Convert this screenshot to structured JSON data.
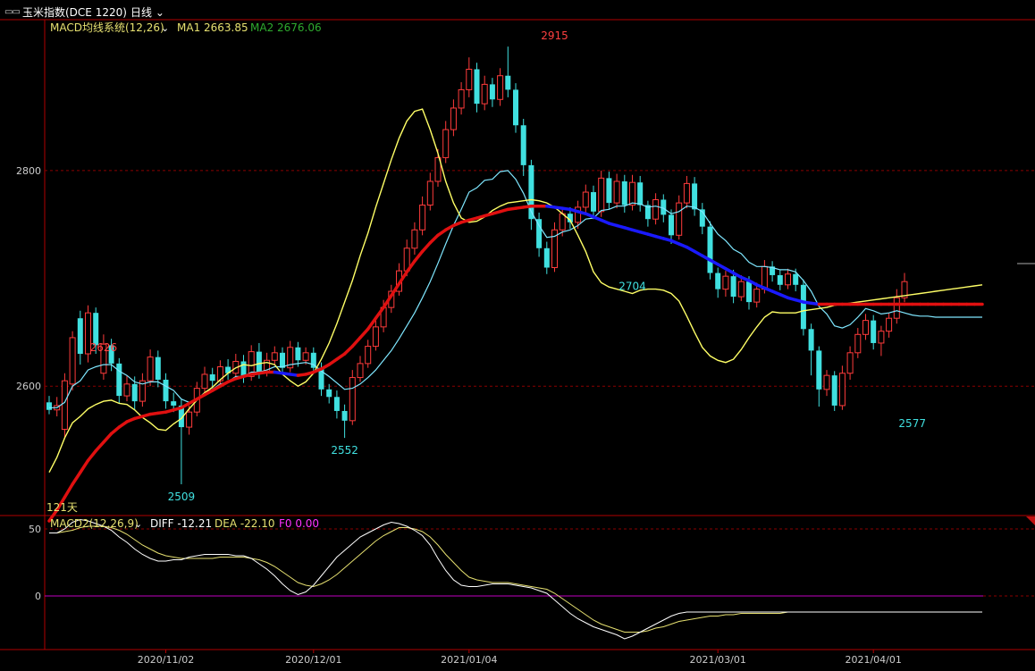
{
  "header": {
    "window_icon": "window-icon",
    "title": "玉米指数(DCE 1220)",
    "period": "日线",
    "period_dropdown_icon": "chevron-down-icon"
  },
  "main_panel": {
    "indicator_name": "MACD均线系统(12,26)",
    "ma1_label": "MA1 2663.85",
    "ma2_label": "MA2 2676.06",
    "day_count_label": "121天",
    "y_ticks": [
      {
        "value": 2800,
        "label": "2800"
      },
      {
        "value": 2600,
        "label": "2600"
      }
    ],
    "peak_labels": [
      {
        "index": 7,
        "value": 2626,
        "label": "2626",
        "kind": "high"
      },
      {
        "index": 17,
        "value": 2509,
        "label": "2509",
        "kind": "low"
      },
      {
        "index": 38,
        "value": 2552,
        "label": "2552",
        "kind": "low"
      },
      {
        "index": 65,
        "value": 2915,
        "label": "2915",
        "kind": "high"
      },
      {
        "index": 75,
        "value": 2704,
        "label": "2704",
        "kind": "low"
      },
      {
        "index": 111,
        "value": 2577,
        "label": "2577",
        "kind": "low"
      }
    ]
  },
  "sub_panel": {
    "indicator_name": "MACD2(12,26,9)",
    "diff_label": "DIFF -12.21",
    "dea_label": "DEA -22.10",
    "f0_label": "F0 0.00",
    "y_ticks": [
      {
        "value": 50,
        "label": "50"
      },
      {
        "value": 0,
        "label": "0"
      }
    ]
  },
  "x_axis": {
    "date_labels": [
      {
        "index": 15,
        "label": "2020/11/02"
      },
      {
        "index": 34,
        "label": "2020/12/01"
      },
      {
        "index": 54,
        "label": "2021/01/04"
      },
      {
        "index": 86,
        "label": "2021/03/01"
      },
      {
        "index": 106,
        "label": "2021/04/01"
      }
    ]
  },
  "colors": {
    "up": "#ff3b3b",
    "down": "#40e0e0",
    "ma1": "#ffff66",
    "ma2_up": "#e01010",
    "ma2_down": "#1a1aff",
    "ema_fast": "#7fe7ff",
    "grid": "#8b0000",
    "axis": "#b00000",
    "diff": "#ffffff",
    "dea": "#e6e070",
    "zero": "#c000c0"
  },
  "chart_data": {
    "type": "candlestick",
    "period": "daily",
    "count": 121,
    "ylim_main": [
      2480,
      2940
    ],
    "ylim_macd": [
      -40,
      60
    ],
    "candles": [
      [
        2585,
        2578,
        2591,
        2574
      ],
      [
        2578,
        2582,
        2590,
        2572
      ],
      [
        2560,
        2605,
        2612,
        2552
      ],
      [
        2602,
        2645,
        2651,
        2596
      ],
      [
        2663,
        2630,
        2670,
        2620
      ],
      [
        2630,
        2668,
        2675,
        2622
      ],
      [
        2668,
        2638,
        2673,
        2630
      ],
      [
        2612,
        2639,
        2648,
        2606
      ],
      [
        2638,
        2621,
        2644,
        2614
      ],
      [
        2621,
        2591,
        2626,
        2584
      ],
      [
        2591,
        2602,
        2610,
        2586
      ],
      [
        2602,
        2586,
        2609,
        2578
      ],
      [
        2586,
        2605,
        2612,
        2581
      ],
      [
        2605,
        2627,
        2634,
        2600
      ],
      [
        2627,
        2606,
        2633,
        2599
      ],
      [
        2606,
        2586,
        2612,
        2579
      ],
      [
        2586,
        2582,
        2594,
        2576
      ],
      [
        2582,
        2562,
        2588,
        2509
      ],
      [
        2562,
        2576,
        2582,
        2555
      ],
      [
        2576,
        2598,
        2604,
        2572
      ],
      [
        2598,
        2611,
        2618,
        2592
      ],
      [
        2611,
        2605,
        2617,
        2598
      ],
      [
        2605,
        2618,
        2624,
        2600
      ],
      [
        2618,
        2612,
        2625,
        2606
      ],
      [
        2612,
        2623,
        2630,
        2607
      ],
      [
        2623,
        2609,
        2629,
        2603
      ],
      [
        2609,
        2632,
        2638,
        2605
      ],
      [
        2632,
        2613,
        2640,
        2607
      ],
      [
        2613,
        2624,
        2631,
        2609
      ],
      [
        2624,
        2631,
        2637,
        2620
      ],
      [
        2631,
        2617,
        2636,
        2611
      ],
      [
        2617,
        2636,
        2642,
        2613
      ],
      [
        2636,
        2624,
        2641,
        2618
      ],
      [
        2624,
        2631,
        2636,
        2620
      ],
      [
        2631,
        2617,
        2636,
        2612
      ],
      [
        2617,
        2597,
        2622,
        2591
      ],
      [
        2597,
        2590,
        2602,
        2584
      ],
      [
        2590,
        2577,
        2596,
        2570
      ],
      [
        2577,
        2568,
        2583,
        2552
      ],
      [
        2568,
        2608,
        2615,
        2564
      ],
      [
        2608,
        2621,
        2628,
        2604
      ],
      [
        2621,
        2637,
        2643,
        2617
      ],
      [
        2637,
        2655,
        2661,
        2633
      ],
      [
        2655,
        2673,
        2680,
        2650
      ],
      [
        2673,
        2688,
        2694,
        2668
      ],
      [
        2688,
        2707,
        2714,
        2684
      ],
      [
        2707,
        2728,
        2736,
        2702
      ],
      [
        2728,
        2745,
        2752,
        2722
      ],
      [
        2745,
        2768,
        2776,
        2740
      ],
      [
        2768,
        2790,
        2798,
        2763
      ],
      [
        2790,
        2812,
        2820,
        2785
      ],
      [
        2812,
        2838,
        2846,
        2807
      ],
      [
        2838,
        2858,
        2866,
        2832
      ],
      [
        2858,
        2875,
        2882,
        2852
      ],
      [
        2875,
        2894,
        2905,
        2868
      ],
      [
        2894,
        2862,
        2900,
        2854
      ],
      [
        2862,
        2880,
        2888,
        2856
      ],
      [
        2880,
        2866,
        2886,
        2859
      ],
      [
        2866,
        2888,
        2895,
        2860
      ],
      [
        2888,
        2875,
        2915,
        2868
      ],
      [
        2875,
        2842,
        2881,
        2835
      ],
      [
        2842,
        2805,
        2848,
        2795
      ],
      [
        2805,
        2755,
        2810,
        2745
      ],
      [
        2755,
        2728,
        2761,
        2720
      ],
      [
        2728,
        2710,
        2734,
        2704
      ],
      [
        2710,
        2745,
        2752,
        2706
      ],
      [
        2745,
        2760,
        2766,
        2739
      ],
      [
        2760,
        2752,
        2766,
        2746
      ],
      [
        2752,
        2766,
        2772,
        2746
      ],
      [
        2766,
        2780,
        2787,
        2760
      ],
      [
        2780,
        2762,
        2786,
        2755
      ],
      [
        2762,
        2793,
        2800,
        2757
      ],
      [
        2793,
        2770,
        2799,
        2764
      ],
      [
        2770,
        2790,
        2797,
        2765
      ],
      [
        2790,
        2768,
        2796,
        2761
      ],
      [
        2768,
        2789,
        2796,
        2763
      ],
      [
        2789,
        2768,
        2795,
        2762
      ],
      [
        2768,
        2755,
        2772,
        2748
      ],
      [
        2755,
        2773,
        2779,
        2750
      ],
      [
        2773,
        2759,
        2778,
        2752
      ],
      [
        2759,
        2740,
        2764,
        2732
      ],
      [
        2740,
        2770,
        2777,
        2736
      ],
      [
        2770,
        2788,
        2795,
        2765
      ],
      [
        2788,
        2764,
        2794,
        2758
      ],
      [
        2764,
        2748,
        2770,
        2741
      ],
      [
        2748,
        2705,
        2753,
        2699
      ],
      [
        2705,
        2690,
        2710,
        2682
      ],
      [
        2690,
        2702,
        2707,
        2683
      ],
      [
        2702,
        2683,
        2708,
        2677
      ],
      [
        2683,
        2697,
        2703,
        2679
      ],
      [
        2697,
        2678,
        2702,
        2671
      ],
      [
        2678,
        2690,
        2696,
        2673
      ],
      [
        2690,
        2711,
        2717,
        2686
      ],
      [
        2711,
        2703,
        2716,
        2697
      ],
      [
        2703,
        2694,
        2708,
        2689
      ],
      [
        2694,
        2704,
        2709,
        2690
      ],
      [
        2704,
        2694,
        2709,
        2688
      ],
      [
        2694,
        2653,
        2699,
        2647
      ],
      [
        2653,
        2633,
        2658,
        2610
      ],
      [
        2633,
        2597,
        2637,
        2581
      ],
      [
        2597,
        2610,
        2615,
        2591
      ],
      [
        2610,
        2582,
        2614,
        2577
      ],
      [
        2582,
        2612,
        2619,
        2578
      ],
      [
        2612,
        2631,
        2637,
        2606
      ],
      [
        2631,
        2648,
        2654,
        2626
      ],
      [
        2648,
        2661,
        2667,
        2643
      ],
      [
        2661,
        2640,
        2666,
        2634
      ],
      [
        2640,
        2651,
        2656,
        2628
      ],
      [
        2651,
        2663,
        2668,
        2645
      ],
      [
        2663,
        2682,
        2690,
        2658
      ],
      [
        2682,
        2697,
        2705,
        2678
      ]
    ],
    "ma1": [
      2520,
      2534,
      2552,
      2566,
      2572,
      2579,
      2583,
      2586,
      2587,
      2584,
      2583,
      2578,
      2571,
      2566,
      2560,
      2559,
      2565,
      2570,
      2579,
      2587,
      2594,
      2599,
      2606,
      2612,
      2617,
      2620,
      2619,
      2621,
      2622,
      2620,
      2611,
      2605,
      2600,
      2604,
      2612,
      2625,
      2640,
      2658,
      2678,
      2698,
      2721,
      2742,
      2766,
      2788,
      2810,
      2830,
      2846,
      2855,
      2857,
      2838,
      2816,
      2790,
      2770,
      2756,
      2752,
      2753,
      2757,
      2763,
      2767,
      2770,
      2771,
      2772,
      2773,
      2772,
      2770,
      2766,
      2760,
      2754,
      2740,
      2725,
      2706,
      2696,
      2692,
      2690,
      2688,
      2686,
      2689,
      2690,
      2690,
      2689,
      2686,
      2679,
      2665,
      2650,
      2636,
      2628,
      2624,
      2622,
      2625,
      2634,
      2645,
      2655,
      2664,
      2669,
      2668,
      2668,
      2668,
      2670,
      2671,
      2672,
      2673,
      2675,
      2676,
      2677,
      2678,
      2679,
      2680,
      2681,
      2682,
      2683,
      2684,
      2685,
      2686,
      2687,
      2688,
      2689,
      2690,
      2691,
      2692,
      2693,
      2694
    ],
    "ma2": [
      2475,
      2485,
      2497,
      2509,
      2520,
      2531,
      2540,
      2548,
      2556,
      2562,
      2567,
      2570,
      2572,
      2574,
      2575,
      2576,
      2578,
      2580,
      2584,
      2588,
      2592,
      2596,
      2600,
      2604,
      2607,
      2609,
      2611,
      2612,
      2613,
      2613,
      2612,
      2611,
      2610,
      2611,
      2613,
      2616,
      2620,
      2625,
      2630,
      2637,
      2645,
      2653,
      2663,
      2673,
      2684,
      2695,
      2706,
      2716,
      2725,
      2733,
      2740,
      2745,
      2749,
      2752,
      2754,
      2756,
      2758,
      2760,
      2762,
      2764,
      2765,
      2766,
      2767,
      2767,
      2767,
      2766,
      2765,
      2764,
      2762,
      2760,
      2757,
      2754,
      2751,
      2749,
      2747,
      2745,
      2743,
      2741,
      2739,
      2737,
      2735,
      2732,
      2729,
      2725,
      2721,
      2717,
      2713,
      2709,
      2705,
      2701,
      2698,
      2694,
      2691,
      2688,
      2685,
      2682,
      2680,
      2678,
      2677,
      2676,
      2676,
      2676,
      2676,
      2676,
      2676,
      2676,
      2676,
      2676,
      2676,
      2676,
      2676,
      2676,
      2676,
      2676,
      2676,
      2676,
      2676,
      2676,
      2676,
      2676,
      2676
    ],
    "ema_fast": [
      2580,
      2580,
      2585,
      2600,
      2605,
      2615,
      2618,
      2620,
      2620,
      2614,
      2610,
      2604,
      2602,
      2604,
      2604,
      2600,
      2596,
      2588,
      2585,
      2588,
      2594,
      2597,
      2602,
      2604,
      2609,
      2609,
      2613,
      2613,
      2615,
      2618,
      2618,
      2620,
      2621,
      2622,
      2620,
      2614,
      2609,
      2603,
      2597,
      2598,
      2602,
      2608,
      2615,
      2624,
      2633,
      2644,
      2656,
      2668,
      2682,
      2697,
      2714,
      2732,
      2749,
      2764,
      2780,
      2784,
      2791,
      2792,
      2799,
      2800,
      2792,
      2779,
      2762,
      2749,
      2738,
      2739,
      2743,
      2745,
      2749,
      2755,
      2756,
      2763,
      2764,
      2767,
      2767,
      2770,
      2769,
      2766,
      2767,
      2765,
      2760,
      2762,
      2767,
      2766,
      2762,
      2751,
      2741,
      2735,
      2727,
      2723,
      2715,
      2711,
      2711,
      2710,
      2708,
      2708,
      2706,
      2698,
      2688,
      2674,
      2667,
      2656,
      2654,
      2657,
      2664,
      2672,
      2670,
      2667,
      2668,
      2670,
      2668,
      2666,
      2665,
      2665,
      2664,
      2664,
      2664,
      2664,
      2664,
      2664,
      2664
    ],
    "diff": [
      47,
      47,
      50,
      55,
      57,
      56,
      54,
      52,
      49,
      44,
      40,
      35,
      31,
      28,
      26,
      26,
      27,
      27,
      29,
      30,
      31,
      31,
      31,
      31,
      30,
      30,
      28,
      24,
      20,
      15,
      9,
      4,
      1,
      3,
      8,
      15,
      22,
      29,
      34,
      39,
      44,
      47,
      50,
      53,
      55,
      54,
      52,
      49,
      45,
      38,
      28,
      19,
      12,
      8,
      7,
      7,
      8,
      9,
      9,
      9,
      8,
      7,
      6,
      4,
      2,
      -3,
      -8,
      -13,
      -17,
      -20,
      -23,
      -25,
      -27,
      -29,
      -32,
      -30,
      -27,
      -24,
      -21,
      -18,
      -15,
      -13,
      -12,
      -12,
      -12,
      -12,
      -12,
      -12,
      -12,
      -12,
      -12,
      -12,
      -12,
      -12,
      -12,
      -12,
      -12,
      -12,
      -12,
      -12,
      -12,
      -12,
      -12,
      -12,
      -12,
      -12,
      -12,
      -12,
      -12,
      -12,
      -12,
      -12,
      -12,
      -12,
      -12,
      -12,
      -12,
      -12,
      -12,
      -12,
      -12
    ],
    "dea": [
      47,
      47,
      48,
      49,
      51,
      52,
      52,
      52,
      51,
      49,
      46,
      42,
      38,
      35,
      32,
      30,
      29,
      28,
      28,
      28,
      28,
      28,
      29,
      29,
      29,
      29,
      28,
      27,
      25,
      22,
      18,
      14,
      10,
      8,
      7,
      9,
      12,
      16,
      21,
      26,
      31,
      36,
      41,
      45,
      48,
      51,
      51,
      50,
      48,
      44,
      38,
      31,
      25,
      19,
      14,
      12,
      11,
      10,
      10,
      10,
      9,
      8,
      7,
      6,
      5,
      2,
      -2,
      -6,
      -10,
      -14,
      -18,
      -21,
      -23,
      -25,
      -27,
      -27,
      -27,
      -26,
      -24,
      -23,
      -21,
      -19,
      -18,
      -17,
      -16,
      -15,
      -15,
      -14,
      -14,
      -13,
      -13,
      -13,
      -13,
      -13,
      -13,
      -12,
      -12,
      -12,
      -12,
      -12,
      -12,
      -12,
      -12,
      -12,
      -12,
      -12,
      -12,
      -12,
      -12,
      -12,
      -12,
      -12,
      -12,
      -12,
      -12,
      -12,
      -12,
      -12,
      -12,
      -12,
      -12
    ]
  }
}
